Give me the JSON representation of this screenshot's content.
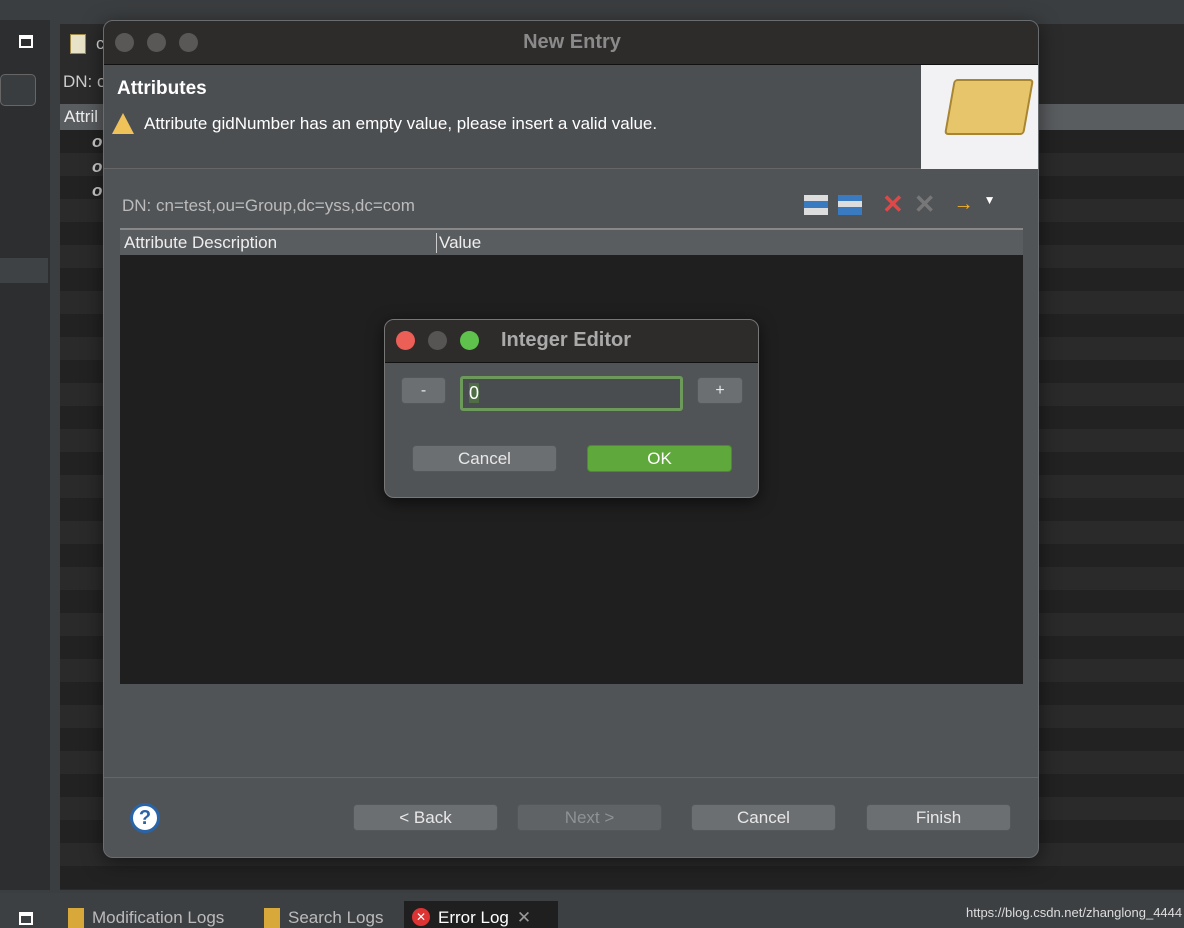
{
  "background": {
    "tab_partial": "c",
    "dn_partial": "DN: c",
    "attr_partial": "Attril",
    "rows_partial": [
      "o",
      "o",
      "o"
    ]
  },
  "dialog": {
    "title": "New Entry",
    "header_title": "Attributes",
    "warning": "Attribute gidNumber has an empty value, please insert a valid value.",
    "dn": "DN: cn=test,ou=Group,dc=yss,dc=com",
    "columns": [
      "Attribute Description",
      "Value"
    ],
    "toolbar": [
      "new-attribute-icon",
      "new-value-icon",
      "delete-icon",
      "delete-all-icon",
      "forward-icon",
      "menu-dropdown-icon"
    ],
    "buttons": {
      "back": "< Back",
      "next": "Next >",
      "cancel": "Cancel",
      "finish": "Finish"
    }
  },
  "integer_editor": {
    "title": "Integer Editor",
    "minus": "-",
    "plus": "+",
    "value": "0",
    "cancel": "Cancel",
    "ok": "OK"
  },
  "bottom_tabs": [
    "Modification Logs",
    "Search Logs",
    "Error Log"
  ],
  "watermark": "https://blog.csdn.net/zhanglong_4444",
  "colors": {
    "ok": "#5fa83c",
    "focus": "#6c9a5a",
    "close": "#ec5f57",
    "zoom": "#5fc24c"
  }
}
